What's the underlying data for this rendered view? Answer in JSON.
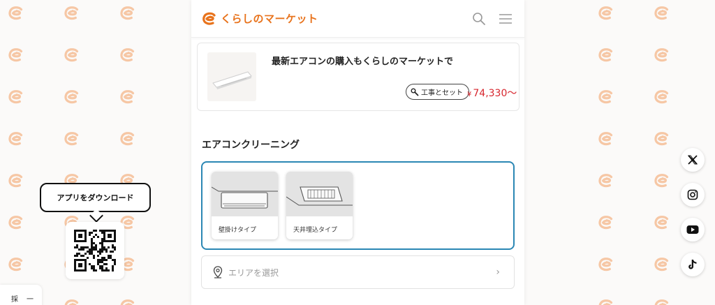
{
  "brand": {
    "logo_text": "くらしのマーケット",
    "accent": "#e8731c"
  },
  "header": {
    "search_icon": "search-icon",
    "menu_icon": "menu-icon"
  },
  "promo": {
    "title": "最新エアコンの購入もくらしのマーケットで",
    "badge_label": "工事とセット",
    "price_symbol": "¥",
    "price_value": "74,330",
    "price_suffix": "〜",
    "price_color": "#d7262e"
  },
  "cleaning": {
    "section_title": "エアコンクリーニング",
    "types": [
      {
        "label": "壁掛けタイプ"
      },
      {
        "label": "天井埋込タイプ"
      }
    ]
  },
  "area": {
    "placeholder": "エリアを選択",
    "pin_icon": "location-pin-icon",
    "chevron_icon": "chevron-right-icon"
  },
  "app_promo": {
    "bubble_text": "アプリをダウンロード",
    "qr_alt": "qr-code"
  },
  "recruit": {
    "col1": "採",
    "col2": "一"
  },
  "social": [
    {
      "name": "x",
      "icon": "x-icon"
    },
    {
      "name": "instagram",
      "icon": "instagram-icon"
    },
    {
      "name": "youtube",
      "icon": "youtube-icon"
    },
    {
      "name": "tiktok",
      "icon": "tiktok-icon"
    }
  ]
}
